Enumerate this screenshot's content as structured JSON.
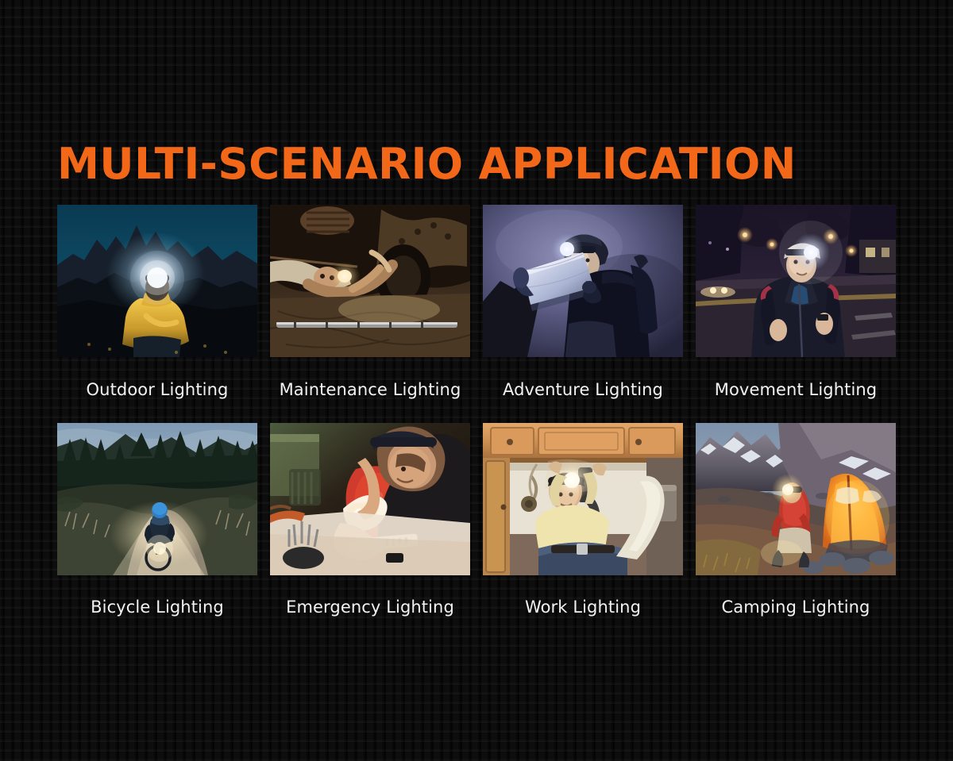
{
  "page": {
    "title": "MULTI-SCENARIO APPLICATION",
    "background_color": "#0a0a0a",
    "accent_color": "#f26818",
    "caption_color": "#f2f2f2"
  },
  "grid": {
    "columns": 4,
    "rows": 2,
    "cards": [
      {
        "id": "outdoor",
        "label": "Outdoor Lighting",
        "scene": "night-mountain-hiker-yellow-jacket-headlamp",
        "colors": {
          "sky": "#0d4a63",
          "glow": "#ffffff",
          "jacket": "#e8b93b",
          "ridge": "#1b2430"
        }
      },
      {
        "id": "maintenance",
        "label": "Maintenance Lighting",
        "scene": "mechanic-under-car-headlamp",
        "colors": {
          "sky": "#2c2118",
          "glow": "#fff3cf",
          "jacket": "#ccbba0",
          "ridge": "#140f0a"
        }
      },
      {
        "id": "adventure",
        "label": "Adventure Lighting",
        "scene": "hiker-reading-map-twilight-headlamp",
        "colors": {
          "sky": "#5b5b85",
          "glow": "#eef0ff",
          "jacket": "#10121c",
          "ridge": "#191a24"
        }
      },
      {
        "id": "movement",
        "label": "Movement Lighting",
        "scene": "night-runner-street-headlamp",
        "colors": {
          "sky": "#241d33",
          "glow": "#ffffff",
          "jacket": "#1d1f2e",
          "ridge": "#3a3040"
        }
      },
      {
        "id": "bicycle",
        "label": "Bicycle Lighting",
        "scene": "mountain-biker-forest-trail-light-beam",
        "colors": {
          "sky": "#8fa6bd",
          "glow": "#fdf6e3",
          "jacket": "#1a2b3d",
          "ridge": "#26302a"
        }
      },
      {
        "id": "emergency",
        "label": "Emergency Lighting",
        "scene": "technician-repair-bench-headlamp-red-light",
        "colors": {
          "sky": "#2a1a14",
          "glow": "#fff6e2",
          "jacket": "#d8392b",
          "ridge": "#4a6b4e"
        }
      },
      {
        "id": "work",
        "label": "Work Lighting",
        "scene": "plumber-under-sink-cabinet-headlamp",
        "colors": {
          "sky": "#c98f56",
          "glow": "#ffffff",
          "jacket": "#ecdfae",
          "ridge": "#2e3c52"
        }
      },
      {
        "id": "camping",
        "label": "Camping Lighting",
        "scene": "camper-glowing-orange-tent-mountain-dusk",
        "colors": {
          "sky": "#7d8fa5",
          "glow": "#ffb13a",
          "jacket": "#c03a2b",
          "ridge": "#5a5560"
        }
      }
    ]
  }
}
